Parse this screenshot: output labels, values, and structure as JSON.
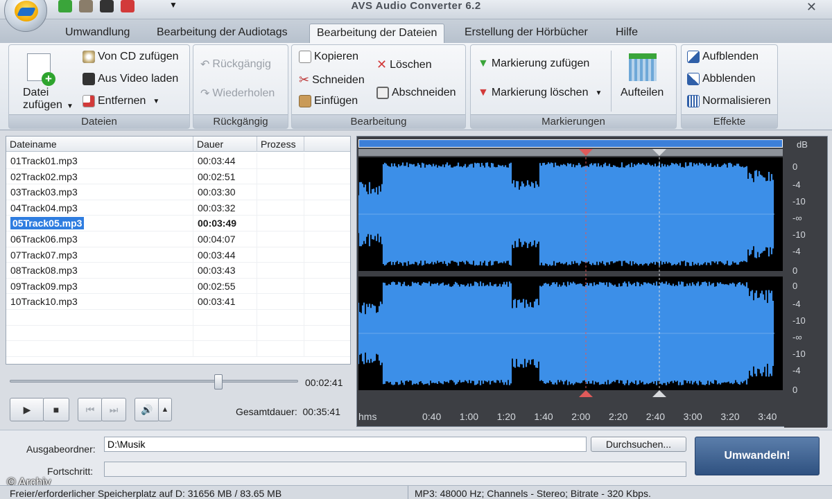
{
  "window": {
    "title": "AVS Audio Converter  6.2",
    "close_glyph": "✕"
  },
  "tabs": [
    {
      "label": "Umwandlung"
    },
    {
      "label": "Bearbeitung der Audiotags"
    },
    {
      "label": "Bearbeitung der Dateien",
      "active": true
    },
    {
      "label": "Erstellung der Hörbücher"
    },
    {
      "label": "Hilfe"
    }
  ],
  "ribbon": {
    "dateien": {
      "label": "Dateien",
      "add_file_line1": "Datei",
      "add_file_line2": "zufügen",
      "from_cd": "Von CD zufügen",
      "from_video": "Aus Video laden",
      "remove": "Entfernen"
    },
    "rueckgaengig": {
      "label": "Rückgängig",
      "undo": "Rückgängig",
      "redo": "Wiederholen"
    },
    "bearbeitung": {
      "label": "Bearbeitung",
      "copy": "Kopieren",
      "cut": "Schneiden",
      "paste": "Einfügen",
      "delete": "Löschen",
      "trim": "Abschneiden"
    },
    "markierungen": {
      "label": "Markierungen",
      "add_marker": "Markierung zufügen",
      "delete_marker": "Markierung löschen",
      "split": "Aufteilen"
    },
    "effekte": {
      "label": "Effekte",
      "fade_in": "Aufblenden",
      "fade_out": "Abblenden",
      "normalize": "Normalisieren"
    }
  },
  "filelist": {
    "columns": [
      "Dateiname",
      "Dauer",
      "Prozess"
    ],
    "rows": [
      {
        "name": "01Track01.mp3",
        "duration": "00:03:44"
      },
      {
        "name": "02Track02.mp3",
        "duration": "00:02:51"
      },
      {
        "name": "03Track03.mp3",
        "duration": "00:03:30"
      },
      {
        "name": "04Track04.mp3",
        "duration": "00:03:32"
      },
      {
        "name": "05Track05.mp3",
        "duration": "00:03:49",
        "selected": true
      },
      {
        "name": "06Track06.mp3",
        "duration": "00:04:07"
      },
      {
        "name": "07Track07.mp3",
        "duration": "00:03:44"
      },
      {
        "name": "08Track08.mp3",
        "duration": "00:03:43"
      },
      {
        "name": "09Track09.mp3",
        "duration": "00:02:55"
      },
      {
        "name": "10Track10.mp3",
        "duration": "00:03:41"
      }
    ]
  },
  "player": {
    "position_fraction": 0.72,
    "current_time": "00:02:41",
    "total_label": "Gesamtdauer:",
    "total_time": "00:35:41",
    "play_glyph": "▶",
    "stop_glyph": "■",
    "prev_glyph": "⏮",
    "next_glyph": "⏭",
    "volume_glyph": "🔊",
    "volume_arrow": "▲"
  },
  "waveform": {
    "db_label": "dB",
    "db_ticks_ch1": [
      "0",
      "-4",
      "-10",
      "-∞",
      "-10",
      "-4",
      "0"
    ],
    "db_ticks_ch2": [
      "0",
      "-4",
      "-10",
      "-∞",
      "-10",
      "-4",
      "0"
    ],
    "time_unit": "hms",
    "time_ticks": [
      "0:40",
      "1:00",
      "1:20",
      "1:40",
      "2:00",
      "2:20",
      "2:40",
      "3:00",
      "3:20",
      "3:40"
    ],
    "colors": {
      "wave": "#3c8fe8",
      "background": "#000000",
      "marker_red": "#e05a5a"
    }
  },
  "output": {
    "folder_label": "Ausgabeordner:",
    "folder_value": "D:\\Musik",
    "browse_label": "Durchsuchen...",
    "progress_label": "Fortschritt:",
    "convert_label": "Umwandeln!"
  },
  "watermark": "© Archiv",
  "status": {
    "left": "Freier/erforderlicher Speicherplatz auf D: 31656 MB / 83.65 MB",
    "right": "MP3: 48000  Hz; Channels - Stereo; Bitrate - 320 Kbps."
  }
}
